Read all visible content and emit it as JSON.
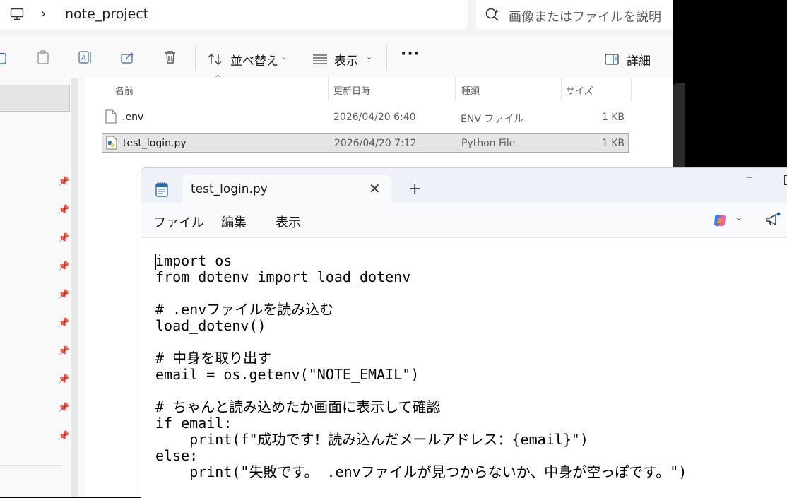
{
  "explorer": {
    "address": {
      "folder": "note_project"
    },
    "search": {
      "placeholder": "画像またはファイルを説明"
    },
    "toolbar": {
      "sort_label": "並べ替え",
      "view_label": "表示",
      "details_label": "詳細"
    },
    "columns": {
      "name": "名前",
      "modified": "更新日時",
      "type": "種類",
      "size": "サイズ"
    },
    "files": [
      {
        "name": ".env",
        "modified": "2026/04/20 6:40",
        "type": "ENV ファイル",
        "size": "1 KB"
      },
      {
        "name": "test_login.py",
        "modified": "2026/04/20 7:12",
        "type": "Python File",
        "size": "1 KB"
      }
    ]
  },
  "notepad": {
    "tab_title": "test_login.py",
    "menus": {
      "file": "ファイル",
      "edit": "編集",
      "view": "表示"
    },
    "code_lines": [
      "import os",
      "from dotenv import load_dotenv",
      "",
      "# .envファイルを読み込む",
      "load_dotenv()",
      "",
      "# 中身を取り出す",
      "email = os.getenv(\"NOTE_EMAIL\")",
      "",
      "# ちゃんと読み込めたか画面に表示して確認",
      "if email:",
      "    print(f\"成功です！読み込んだメールアドレス：{email}\")",
      "else:",
      "    print(\"失敗です。 .envファイルが見つからないか、中身が空っぽです。\")"
    ]
  },
  "colors": {
    "accent": "#0067c0",
    "selected_row": "#e5e5e5"
  }
}
